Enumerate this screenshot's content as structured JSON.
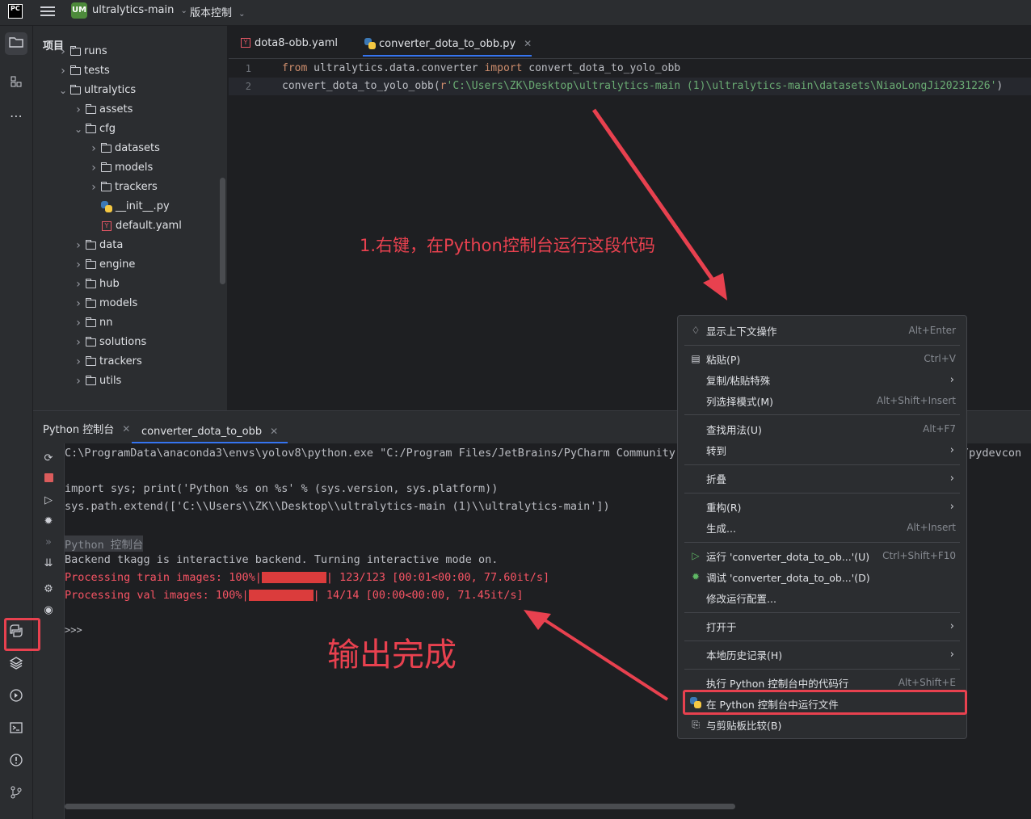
{
  "titlebar": {
    "logo": "PC",
    "project_badge": "UM",
    "project_name": "ultralytics-main",
    "vcs_menu": "版本控制"
  },
  "project_panel": {
    "title": "项目",
    "items": [
      {
        "label": "runs",
        "indent": 1,
        "type": "folder",
        "expanded": false
      },
      {
        "label": "tests",
        "indent": 1,
        "type": "folder",
        "expanded": false
      },
      {
        "label": "ultralytics",
        "indent": 1,
        "type": "folder",
        "expanded": true
      },
      {
        "label": "assets",
        "indent": 2,
        "type": "folder",
        "expanded": false
      },
      {
        "label": "cfg",
        "indent": 2,
        "type": "folder",
        "expanded": true
      },
      {
        "label": "datasets",
        "indent": 3,
        "type": "folder",
        "expanded": false
      },
      {
        "label": "models",
        "indent": 3,
        "type": "folder",
        "expanded": false
      },
      {
        "label": "trackers",
        "indent": 3,
        "type": "folder",
        "expanded": false
      },
      {
        "label": "__init__.py",
        "indent": 3,
        "type": "python"
      },
      {
        "label": "default.yaml",
        "indent": 3,
        "type": "yaml"
      },
      {
        "label": "data",
        "indent": 2,
        "type": "folder",
        "expanded": false
      },
      {
        "label": "engine",
        "indent": 2,
        "type": "folder",
        "expanded": false
      },
      {
        "label": "hub",
        "indent": 2,
        "type": "folder",
        "expanded": false
      },
      {
        "label": "models",
        "indent": 2,
        "type": "folder",
        "expanded": false
      },
      {
        "label": "nn",
        "indent": 2,
        "type": "folder",
        "expanded": false
      },
      {
        "label": "solutions",
        "indent": 2,
        "type": "folder",
        "expanded": false
      },
      {
        "label": "trackers",
        "indent": 2,
        "type": "folder",
        "expanded": false
      },
      {
        "label": "utils",
        "indent": 2,
        "type": "folder",
        "expanded": false
      }
    ]
  },
  "editor": {
    "tabs": [
      {
        "label": "dota8-obb.yaml",
        "icon": "yaml-icon"
      },
      {
        "label": "converter_dota_to_obb.py",
        "icon": "python-icon",
        "active": true
      }
    ],
    "line_numbers": [
      "1",
      "2"
    ],
    "line1": {
      "kw1": "from",
      "mod": " ultralytics.data.converter ",
      "kw2": "import",
      "name": " convert_dota_to_yolo_obb"
    },
    "line2": {
      "fn": "convert_dota_to_yolo_obb(",
      "prefix": "r",
      "str": "'C:\\Users\\ZK\\Desktop\\ultralytics-main (1)\\ultralytics-main\\datasets\\NiaoLongJi20231226'",
      "close": ")"
    }
  },
  "bottom_panel": {
    "tabs": [
      {
        "label": "Python 控制台"
      },
      {
        "label": "converter_dota_to_obb",
        "active": true
      }
    ],
    "console": {
      "cmd": "C:\\ProgramData\\anaconda3\\envs\\yolov8\\python.exe \"C:/Program Files/JetBrains/PyCharm Community E",
      "cmd_tail": "/pydevcon",
      "import_line": "import sys; print('Python %s on %s' % (sys.version, sys.platform))",
      "path_line": "sys.path.extend(['C:\\\\Users\\\\ZK\\\\Desktop\\\\ultralytics-main (1)\\\\ultralytics-main'])",
      "console_label": "Python 控制台",
      "backend_line": "Backend tkagg is interactive backend. Turning interactive mode on.",
      "train_prefix": "Processing train images: 100%|",
      "train_suffix": "| 123/123 [00:01<00:00, 77.60it/s]",
      "train_progress": 1.0,
      "val_prefix": "Processing val images: 100%|",
      "val_suffix": "| 14/14 [00:00<00:00, 71.45it/s]",
      "val_progress": 1.0,
      "prompt": ">>>"
    }
  },
  "context_menu": {
    "items": [
      {
        "icon": "lightbulb-icon",
        "label": "显示上下文操作",
        "shortcut": "Alt+Enter"
      },
      {
        "icon": "clipboard-icon",
        "label": "粘贴(P)",
        "shortcut": "Ctrl+V"
      },
      {
        "label": "复制/粘贴特殊",
        "submenu": true
      },
      {
        "label": "列选择模式(M)",
        "shortcut": "Alt+Shift+Insert"
      },
      {
        "label": "查找用法(U)",
        "shortcut": "Alt+F7"
      },
      {
        "label": "转到",
        "submenu": true
      },
      {
        "label": "折叠",
        "submenu": true
      },
      {
        "label": "重构(R)",
        "submenu": true
      },
      {
        "label": "生成...",
        "shortcut": "Alt+Insert"
      },
      {
        "icon": "run-icon",
        "label": "运行 'converter_dota_to_ob...'(U)",
        "shortcut": "Ctrl+Shift+F10"
      },
      {
        "icon": "debug-icon",
        "label": "调试 'converter_dota_to_ob...'(D)"
      },
      {
        "label": "修改运行配置..."
      },
      {
        "label": "打开于",
        "submenu": true
      },
      {
        "label": "本地历史记录(H)",
        "submenu": true
      },
      {
        "label": "执行 Python 控制台中的代码行",
        "shortcut": "Alt+Shift+E"
      },
      {
        "icon": "python-icon",
        "label": "在 Python 控制台中运行文件"
      },
      {
        "icon": "compare-icon",
        "label": "与剪贴板比较(B)"
      }
    ]
  },
  "annotations": {
    "step1": "1.右键，在Python控制台运行这段代码",
    "done": "输出完成"
  },
  "colors": {
    "accent": "#3574f0",
    "annotation_red": "#e8414f",
    "progress_red": "#f75464"
  }
}
